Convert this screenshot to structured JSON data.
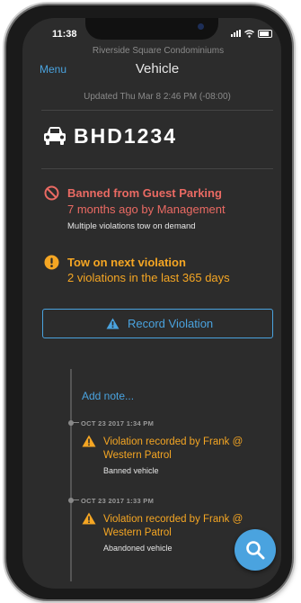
{
  "status_bar": {
    "time": "11:38"
  },
  "header": {
    "property_name": "Riverside Square Condominiums",
    "menu_label": "Menu",
    "title": "Vehicle",
    "updated": "Updated Thu Mar 8 2:46 PM (-08:00)"
  },
  "vehicle": {
    "plate": "BHD1234",
    "icon": "car-icon"
  },
  "alerts": [
    {
      "icon": "ban-icon",
      "color": "#ea6a63",
      "title": "Banned from Guest Parking",
      "subtitle": "7 months ago by Management",
      "detail": "Multiple violations tow on demand"
    },
    {
      "icon": "exclamation-circle-icon",
      "color": "#f5a623",
      "title": "Tow on next violation",
      "subtitle": "2 violations in the last 365 days"
    }
  ],
  "record_button": {
    "label": "Record Violation",
    "icon": "warning-icon",
    "color": "#4aa3df"
  },
  "timeline": {
    "add_note_label": "Add note...",
    "events": [
      {
        "date": "OCT 23 2017 1:34 PM",
        "title": "Violation recorded by Frank @ Western Patrol",
        "detail": "Banned vehicle",
        "icon": "warning-icon"
      },
      {
        "date": "OCT 23 2017 1:33 PM",
        "title": "Violation recorded by Frank @ Western Patrol",
        "detail": "Abandoned vehicle",
        "icon": "warning-icon"
      }
    ]
  },
  "fab": {
    "icon": "search-icon"
  },
  "colors": {
    "background": "#2c2c2c",
    "accent": "#4aa3df",
    "danger": "#ea6a63",
    "warning": "#f5a623"
  }
}
